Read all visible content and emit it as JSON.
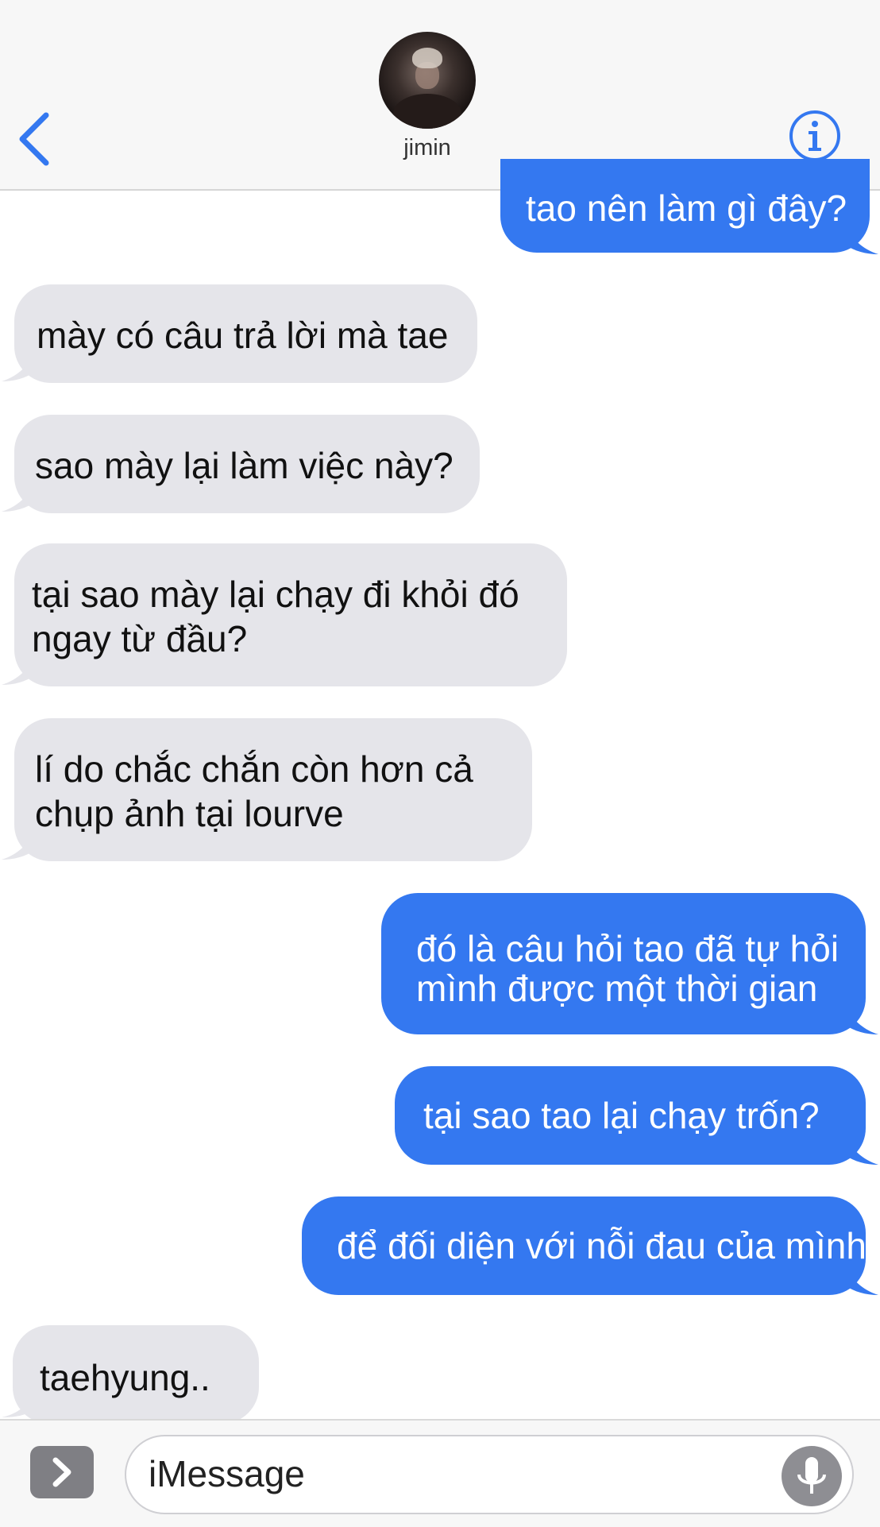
{
  "header": {
    "contact_name": "jimin",
    "back_icon": "chevron-left-icon",
    "info_icon": "info-icon",
    "accent_color": "#3478f0"
  },
  "messages": [
    {
      "direction": "out",
      "lines": [
        "tao nên làm gì đây?"
      ]
    },
    {
      "direction": "in",
      "lines": [
        "mày có câu trả lời mà tae"
      ]
    },
    {
      "direction": "in",
      "lines": [
        "sao mày lại làm việc này?"
      ]
    },
    {
      "direction": "in",
      "lines": [
        "tại sao mày lại chạy đi khỏi đó",
        "ngay từ đầu?"
      ]
    },
    {
      "direction": "in",
      "lines": [
        "lí do chắc chắn còn hơn cả",
        "chụp ảnh tại lourve"
      ]
    },
    {
      "direction": "out",
      "lines": [
        "đó là câu hỏi tao đã tự hỏi",
        "mình được một thời gian"
      ]
    },
    {
      "direction": "out",
      "lines": [
        "tại sao tao lại chạy trốn?"
      ]
    },
    {
      "direction": "out",
      "lines": [
        "để đối diện với nỗi đau của mình"
      ]
    },
    {
      "direction": "in",
      "lines": [
        "taehyung.."
      ]
    }
  ],
  "input_bar": {
    "placeholder": "iMessage",
    "apps_icon": "chevron-right-icon",
    "mic_icon": "microphone-icon"
  },
  "colors": {
    "incoming_bubble": "#e5e5ea",
    "outgoing_bubble": "#3478f0"
  }
}
